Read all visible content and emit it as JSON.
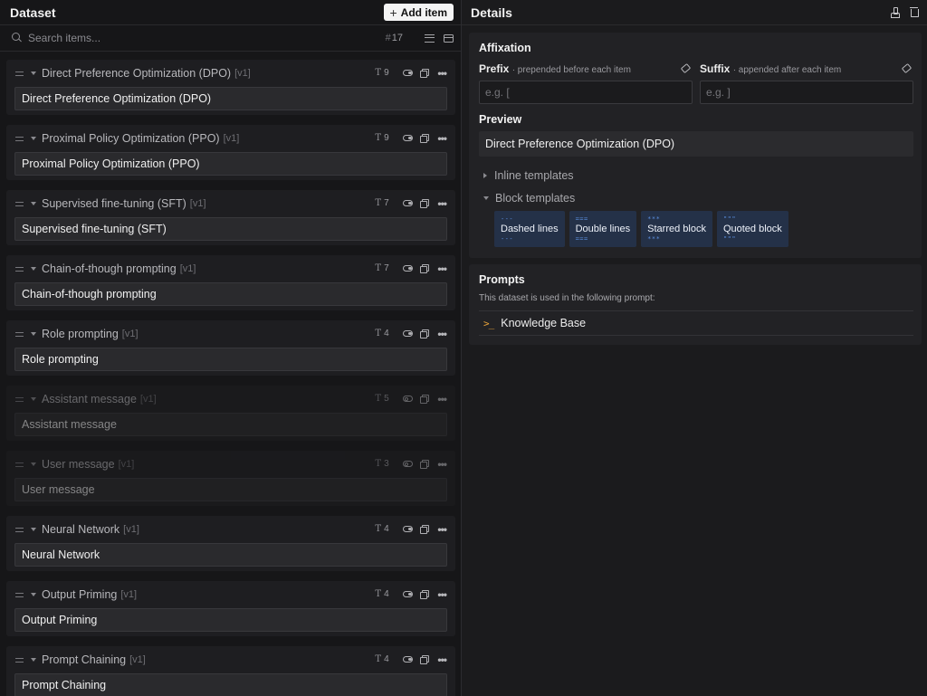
{
  "dataset": {
    "title": "Dataset",
    "add_label": "Add item",
    "search_placeholder": "Search items...",
    "count_hash": "#",
    "count": "17"
  },
  "items": [
    {
      "title": "Direct Preference Optimization (DPO)",
      "version": "[v1]",
      "tokens": "9",
      "value": "Direct Preference Optimization (DPO)",
      "enabled": true
    },
    {
      "title": "Proximal Policy Optimization (PPO)",
      "version": "[v1]",
      "tokens": "9",
      "value": "Proximal Policy Optimization (PPO)",
      "enabled": true
    },
    {
      "title": "Supervised fine-tuning (SFT)",
      "version": "[v1]",
      "tokens": "7",
      "value": "Supervised fine-tuning (SFT)",
      "enabled": true
    },
    {
      "title": "Chain-of-though prompting",
      "version": "[v1]",
      "tokens": "7",
      "value": "Chain-of-though prompting",
      "enabled": true
    },
    {
      "title": "Role prompting",
      "version": "[v1]",
      "tokens": "4",
      "value": "Role prompting",
      "enabled": true
    },
    {
      "title": "Assistant message",
      "version": "[v1]",
      "tokens": "5",
      "value": "Assistant message",
      "enabled": false
    },
    {
      "title": "User message",
      "version": "[v1]",
      "tokens": "3",
      "value": "User message",
      "enabled": false
    },
    {
      "title": "Neural Network",
      "version": "[v1]",
      "tokens": "4",
      "value": "Neural Network",
      "enabled": true
    },
    {
      "title": "Output Priming",
      "version": "[v1]",
      "tokens": "4",
      "value": "Output Priming",
      "enabled": true
    },
    {
      "title": "Prompt Chaining",
      "version": "[v1]",
      "tokens": "4",
      "value": "Prompt Chaining",
      "enabled": true
    }
  ],
  "details": {
    "title": "Details",
    "affixation": {
      "title": "Affixation",
      "prefix_label": "Prefix",
      "prefix_sub": "· prepended before each item",
      "prefix_placeholder": "e.g. [",
      "suffix_label": "Suffix",
      "suffix_sub": "· appended after each item",
      "suffix_placeholder": "e.g. ]",
      "preview_title": "Preview",
      "preview_value": "Direct Preference Optimization (DPO)",
      "inline_templates": "Inline templates",
      "block_templates": "Block templates",
      "templates": [
        {
          "label": "Dashed lines",
          "marker": "---"
        },
        {
          "label": "Double lines",
          "marker": "==="
        },
        {
          "label": "Starred block",
          "marker": "***"
        },
        {
          "label": "Quoted block",
          "marker": "\"\"\""
        }
      ]
    },
    "prompts": {
      "title": "Prompts",
      "description": "This dataset is used in the following prompt:",
      "items": [
        "Knowledge Base"
      ]
    }
  },
  "icons": {
    "accent": "#5b8fe0",
    "prompt_icon_color": "#e8a33a"
  }
}
